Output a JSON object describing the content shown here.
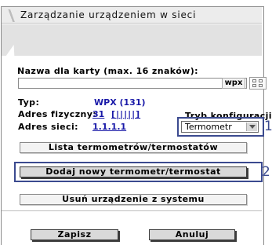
{
  "window": {
    "title": "Zarządzanie urządzeniem w sieci"
  },
  "form": {
    "name_label": "Nazwa dla karty (max. 16 znaków):",
    "name_value": "",
    "name_suffix": "wpx",
    "type_label": "Typ:",
    "type_value": "WPX (131)",
    "phys_label": "Adres fizyczny:",
    "phys_value": "31",
    "phys_bits": "[|||||]",
    "net_label": "Adres sieci:",
    "net_value": "1.1.1.1",
    "mode_label": "Tryb konfiguracji",
    "mode_value": "Termometr"
  },
  "buttons": {
    "list": "Lista termometrów/termostatów",
    "add": "Dodaj nowy termometr/termostat",
    "remove": "Usuń urządzenie z systemu",
    "save": "Zapisz",
    "cancel": "Anuluj"
  },
  "callouts": {
    "one": "1",
    "two": "2"
  },
  "colors": {
    "accent": "#1a1aa8",
    "callout": "#3b4a8f"
  }
}
